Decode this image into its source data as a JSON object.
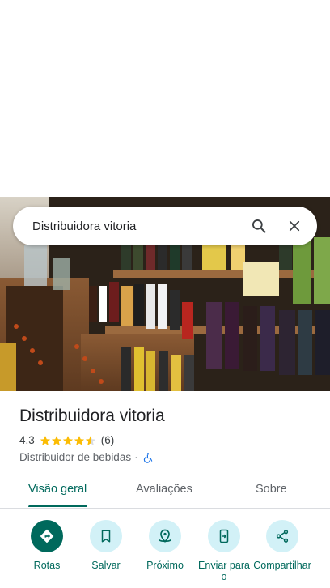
{
  "search": {
    "query": "Distribuidora vitoria",
    "icons": [
      "search-icon",
      "close-icon"
    ]
  },
  "place": {
    "name": "Distribuidora vitoria",
    "rating": "4,3",
    "rating_value": 4.3,
    "stars_max": 5,
    "review_count": "(6)",
    "category": "Distribuidor de bebidas",
    "separator": "·",
    "accessibility_icon": "wheelchair-icon"
  },
  "tabs": [
    {
      "label": "Visão geral",
      "active": true
    },
    {
      "label": "Avaliações",
      "active": false
    },
    {
      "label": "Sobre",
      "active": false
    }
  ],
  "actions": [
    {
      "label": "Rotas",
      "icon": "directions-icon"
    },
    {
      "label": "Salvar",
      "icon": "bookmark-icon"
    },
    {
      "label": "Próximo",
      "icon": "nearby-icon"
    },
    {
      "label": "Enviar para o",
      "icon": "send-to-phone-icon"
    },
    {
      "label": "Compartilhar",
      "icon": "share-icon"
    }
  ],
  "colors": {
    "accent": "#00695c",
    "action_bg": "#d2f1f7",
    "star": "#fbbc04"
  }
}
